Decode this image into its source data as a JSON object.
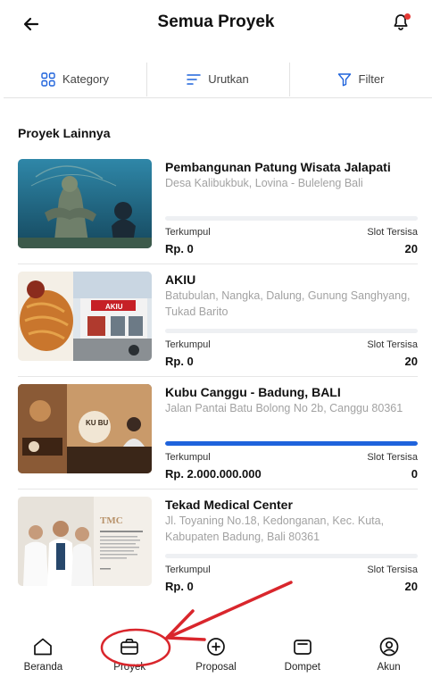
{
  "header": {
    "title": "Semua Proyek",
    "back_icon": "arrow-left-icon",
    "notification_icon": "bell-icon",
    "notification_dot_color": "#e53935"
  },
  "filters": [
    {
      "label": "Kategory",
      "icon": "grid-icon"
    },
    {
      "label": "Urutkan",
      "icon": "sort-icon"
    },
    {
      "label": "Filter",
      "icon": "funnel-icon"
    }
  ],
  "section": {
    "title": "Proyek Lainnya"
  },
  "labels": {
    "collected": "Terkumpul",
    "slots": "Slot Tersisa"
  },
  "projects": [
    {
      "name": "Pembangunan Patung Wisata Jalapati",
      "address": "Desa Kalibukbuk, Lovina - Buleleng Bali",
      "collected": "Rp. 0",
      "slots": "20",
      "progress": 0
    },
    {
      "name": "AKIU",
      "address": "Batubulan, Nangka, Dalung, Gunung Sanghyang, Tukad Barito",
      "collected": "Rp. 0",
      "slots": "20",
      "progress": 0
    },
    {
      "name": "Kubu Canggu - Badung, BALI",
      "address": "Jalan Pantai Batu Bolong No 2b, Canggu 80361",
      "collected": "Rp. 2.000.000.000",
      "slots": "0",
      "progress": 1.0
    },
    {
      "name": "Tekad Medical Center",
      "address": "Jl. Toyaning No.18, Kedonganan, Kec. Kuta, Kabupaten Badung, Bali 80361",
      "collected": "Rp. 0",
      "slots": "20",
      "progress": 0
    }
  ],
  "thumb_text": {
    "akiu_sign": "AKIU",
    "kubu_logo": "KU BU",
    "tmc_logo": "TMC"
  },
  "nav": [
    {
      "label": "Beranda",
      "icon": "home-icon"
    },
    {
      "label": "Proyek",
      "icon": "briefcase-icon"
    },
    {
      "label": "Proposal",
      "icon": "plus-circle-icon"
    },
    {
      "label": "Dompet",
      "icon": "wallet-icon"
    },
    {
      "label": "Akun",
      "icon": "user-circle-icon"
    }
  ],
  "colors": {
    "accent": "#1f63dc",
    "annotation": "#d9262c",
    "muted_text": "#a2a2a2"
  }
}
